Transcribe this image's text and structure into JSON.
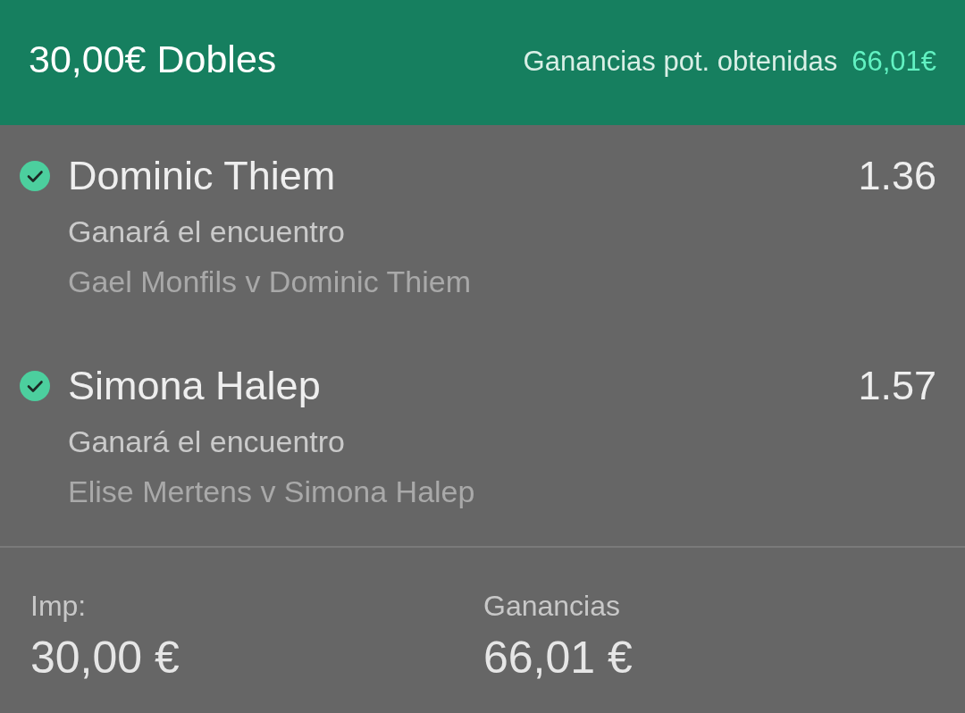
{
  "header": {
    "title": "30,00€ Dobles",
    "potential_label": "Ganancias pot. obtenidas",
    "potential_amount": "66,01€"
  },
  "selections": [
    {
      "name": "Dominic Thiem",
      "odds": "1.36",
      "market": "Ganará el encuentro",
      "event": "Gael Monfils v Dominic Thiem",
      "won": true
    },
    {
      "name": "Simona Halep",
      "odds": "1.57",
      "market": "Ganará el encuentro",
      "event": "Elise Mertens v Simona Halep",
      "won": true
    }
  ],
  "summary": [
    {
      "label": "Imp:",
      "value": "30,00 €"
    },
    {
      "label": "Ganancias",
      "value": "66,01 €"
    }
  ]
}
